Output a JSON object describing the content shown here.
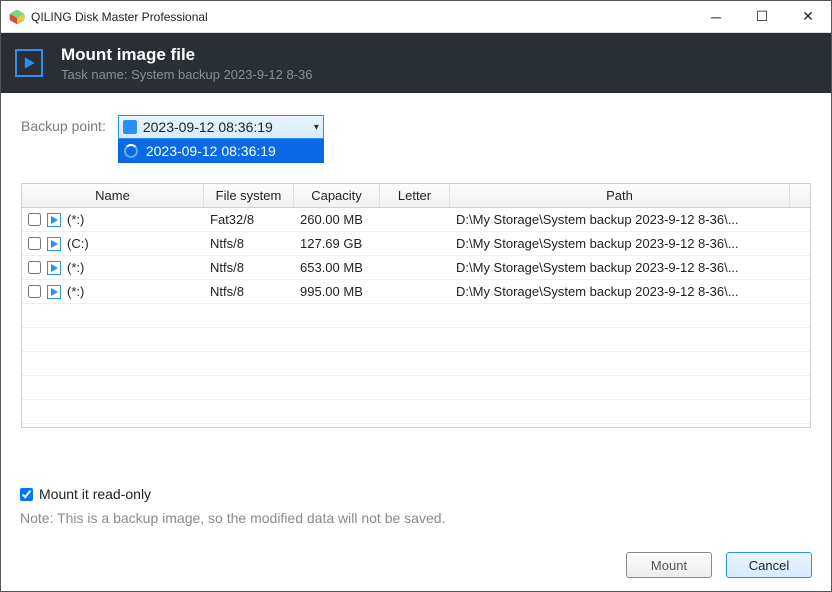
{
  "app": {
    "title": "QILING Disk Master Professional"
  },
  "header": {
    "title": "Mount image file",
    "subtitle": "Task name: System backup 2023-9-12 8-36"
  },
  "backup_point": {
    "label": "Backup point:",
    "selected": "2023-09-12 08:36:19",
    "options": [
      "2023-09-12 08:36:19"
    ]
  },
  "table": {
    "columns": {
      "name": "Name",
      "fs": "File system",
      "cap": "Capacity",
      "letter": "Letter",
      "path": "Path"
    },
    "rows": [
      {
        "name": "(*:)",
        "fs": "Fat32/8",
        "cap": "260.00 MB",
        "letter": "",
        "path": "D:\\My Storage\\System backup 2023-9-12 8-36\\..."
      },
      {
        "name": "(C:)",
        "fs": "Ntfs/8",
        "cap": "127.69 GB",
        "letter": "",
        "path": "D:\\My Storage\\System backup 2023-9-12 8-36\\..."
      },
      {
        "name": "(*:)",
        "fs": "Ntfs/8",
        "cap": "653.00 MB",
        "letter": "",
        "path": "D:\\My Storage\\System backup 2023-9-12 8-36\\..."
      },
      {
        "name": "(*:)",
        "fs": "Ntfs/8",
        "cap": "995.00 MB",
        "letter": "",
        "path": "D:\\My Storage\\System backup 2023-9-12 8-36\\..."
      }
    ]
  },
  "readonly": {
    "label": "Mount it read-only",
    "checked": true
  },
  "note": "Note: This is a backup image, so the modified data will not be saved.",
  "buttons": {
    "mount": "Mount",
    "cancel": "Cancel"
  }
}
